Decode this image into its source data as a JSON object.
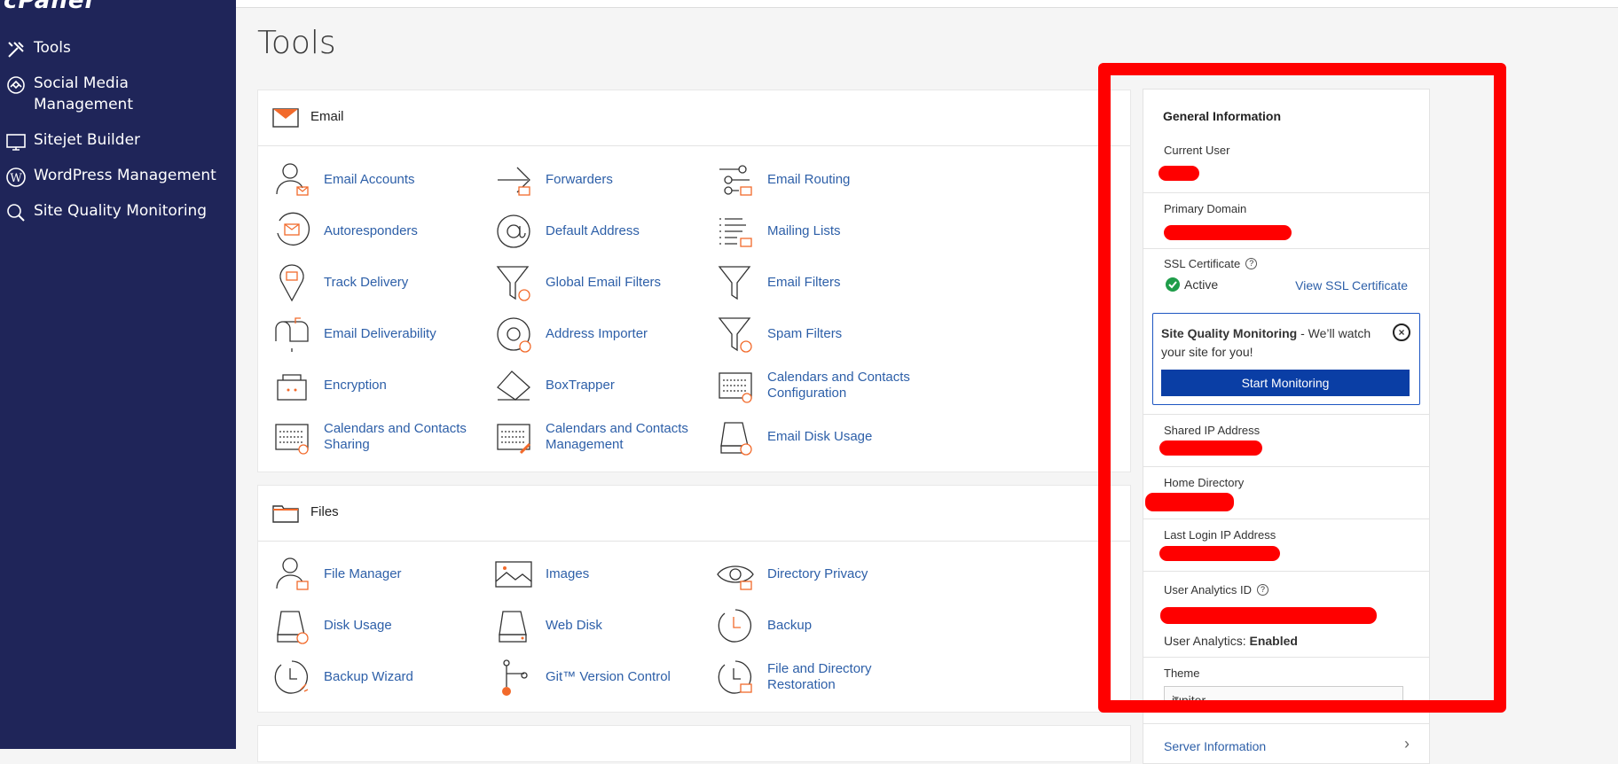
{
  "sidebar": {
    "logo": "cPanel",
    "items": [
      {
        "label": "Tools",
        "icon": "tools-icon"
      },
      {
        "label": "Social Media Management",
        "icon": "social-media-icon"
      },
      {
        "label": "Sitejet Builder",
        "icon": "sitejet-icon"
      },
      {
        "label": "WordPress Management",
        "icon": "wordpress-icon"
      },
      {
        "label": "Site Quality Monitoring",
        "icon": "site-quality-icon"
      }
    ]
  },
  "page": {
    "title": "Tools"
  },
  "email": {
    "title": "Email",
    "tools": [
      {
        "label": "Email Accounts",
        "icon": "user-mail-icon"
      },
      {
        "label": "Forwarders",
        "icon": "forward-arrow-icon"
      },
      {
        "label": "Email Routing",
        "icon": "routing-icon"
      },
      {
        "label": "Autoresponders",
        "icon": "autoresponder-icon"
      },
      {
        "label": "Default Address",
        "icon": "at-sign-icon"
      },
      {
        "label": "Mailing Lists",
        "icon": "list-mail-icon"
      },
      {
        "label": "Track Delivery",
        "icon": "map-pin-mail-icon"
      },
      {
        "label": "Global Email Filters",
        "icon": "funnel-globe-icon"
      },
      {
        "label": "Email Filters",
        "icon": "funnel-icon"
      },
      {
        "label": "Email Deliverability",
        "icon": "mailbox-icon"
      },
      {
        "label": "Address Importer",
        "icon": "at-import-icon"
      },
      {
        "label": "Spam Filters",
        "icon": "funnel-alert-icon"
      },
      {
        "label": "Encryption",
        "icon": "lock-icon"
      },
      {
        "label": "BoxTrapper",
        "icon": "boxtrapper-icon"
      },
      {
        "label": "Calendars and Contacts Configuration",
        "icon": "calendar-at-icon"
      },
      {
        "label": "Calendars and Contacts Sharing",
        "icon": "calendar-share-icon"
      },
      {
        "label": "Calendars and Contacts Management",
        "icon": "calendar-edit-icon"
      },
      {
        "label": "Email Disk Usage",
        "icon": "disk-usage-icon"
      }
    ]
  },
  "files": {
    "title": "Files",
    "tools": [
      {
        "label": "File Manager",
        "icon": "file-manager-icon"
      },
      {
        "label": "Images",
        "icon": "image-icon"
      },
      {
        "label": "Directory Privacy",
        "icon": "eye-icon"
      },
      {
        "label": "Disk Usage",
        "icon": "disk-icon"
      },
      {
        "label": "Web Disk",
        "icon": "web-disk-icon"
      },
      {
        "label": "Backup",
        "icon": "backup-icon"
      },
      {
        "label": "Backup Wizard",
        "icon": "backup-wizard-icon"
      },
      {
        "label": "Git™ Version Control",
        "icon": "git-icon"
      },
      {
        "label": "File and Directory Restoration",
        "icon": "restore-icon"
      }
    ]
  },
  "general_info": {
    "title": "General Information",
    "current_user_label": "Current User",
    "primary_domain_label": "Primary Domain",
    "ssl_label": "SSL Certificate",
    "ssl_status": "Active",
    "ssl_link": "View SSL Certificate",
    "sqm_title": "Site Quality Monitoring",
    "sqm_text": " - We’ll watch your site for you!",
    "sqm_button": "Start Monitoring",
    "shared_ip_label": "Shared IP Address",
    "home_dir_label": "Home Directory",
    "last_login_label": "Last Login IP Address",
    "analytics_id_label": "User Analytics ID",
    "analytics_label": "User Analytics:",
    "analytics_value": "Enabled",
    "theme_label": "Theme",
    "theme_value": "jupiter",
    "server_info_label": "Server Information"
  },
  "colors": {
    "sidebar": "#1f2559",
    "link": "#2d5fa8",
    "accent": "#f26a2b",
    "highlight": "#ff0000"
  }
}
